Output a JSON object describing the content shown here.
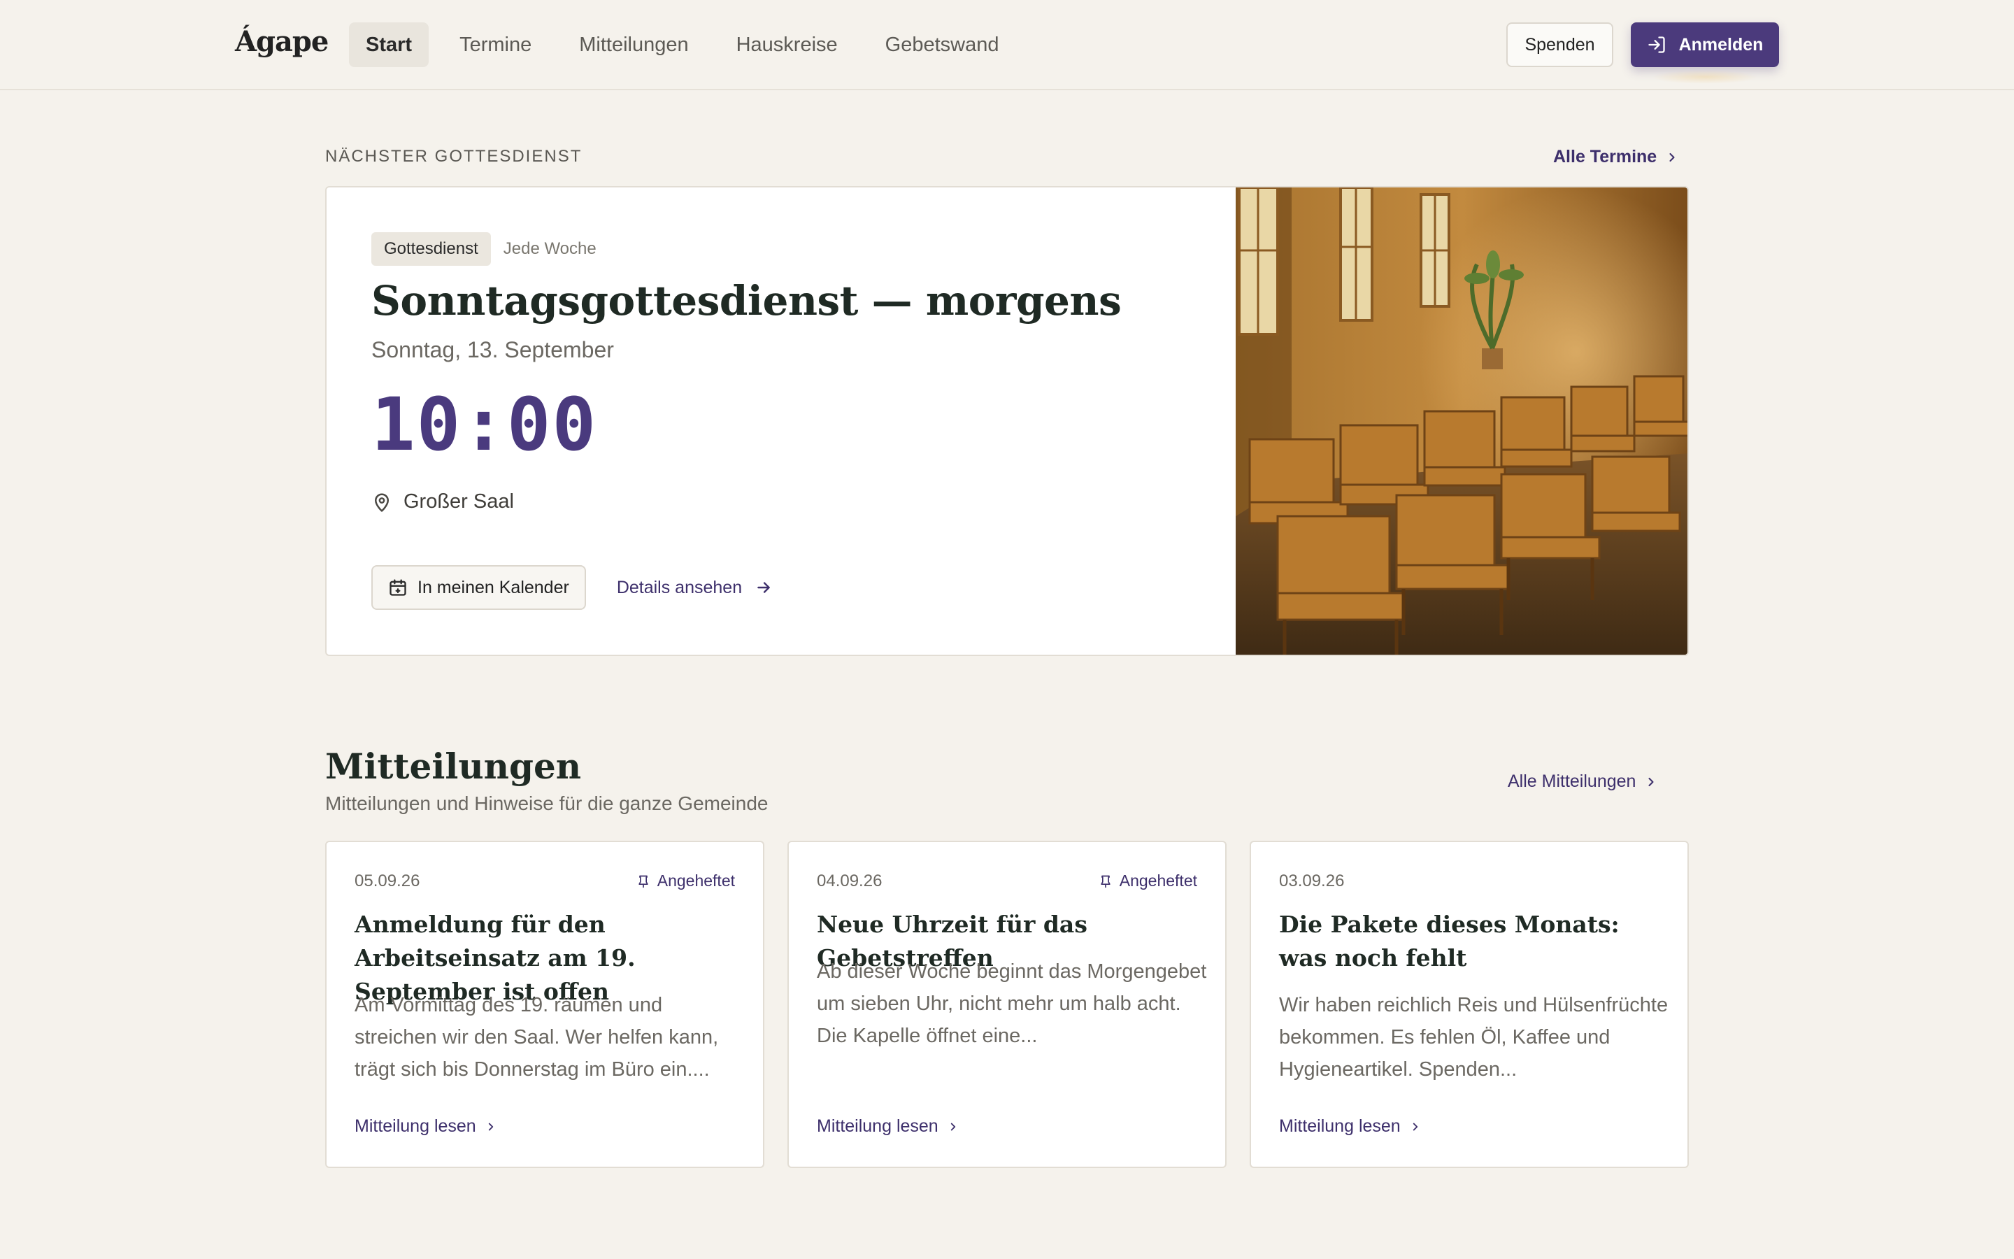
{
  "header": {
    "logo": "Ágape",
    "nav": [
      {
        "label": "Start",
        "active": true
      },
      {
        "label": "Termine"
      },
      {
        "label": "Mitteilungen"
      },
      {
        "label": "Hauskreise"
      },
      {
        "label": "Gebetswand"
      }
    ],
    "donate_label": "Spenden",
    "login_label": "Anmelden"
  },
  "next_service": {
    "section_label": "NÄCHSTER GOTTESDIENST",
    "all_link": "Alle Termine",
    "tag": "Gottesdienst",
    "recurrence": "Jede Woche",
    "title": "Sonntagsgottesdienst — morgens",
    "date": "Sonntag, 13. September",
    "time": "10:00",
    "location": "Großer Saal",
    "calendar_button": "In meinen Kalender",
    "details_link": "Details ansehen",
    "image_description_icon": "church-hall-photo"
  },
  "announcements": {
    "title": "Mitteilungen",
    "subtitle": "Mitteilungen und Hinweise für die ganze Gemeinde",
    "all_link": "Alle Mitteilungen",
    "items": [
      {
        "date": "05.09.26",
        "pinned_label": "Angeheftet",
        "title": "Anmeldung für den Arbeitseinsatz am 19. September ist offen",
        "excerpt": "Am Vormittag des 19. räumen und streichen wir den Saal. Wer helfen kann, trägt sich bis Donnerstag im Büro ein....",
        "link": "Mitteilung lesen"
      },
      {
        "date": "04.09.26",
        "pinned_label": "Angeheftet",
        "title": "Neue Uhrzeit für das Gebetstreffen",
        "excerpt": "Ab dieser Woche beginnt das Morgengebet um sieben Uhr, nicht mehr um halb acht. Die Kapelle öffnet eine...",
        "link": "Mitteilung lesen"
      },
      {
        "date": "03.09.26",
        "pinned_label": "",
        "title": "Die Pakete dieses Monats: was noch fehlt",
        "excerpt": "Wir haben reichlich Reis und Hülsenfrüchte bekommen. Es fehlen Öl, Kaffee und Hygieneartikel. Spenden...",
        "link": "Mitteilung lesen"
      }
    ]
  },
  "colors": {
    "accent": "#4b3a7c",
    "background": "#f5f2ec",
    "time": "#4a3a7e"
  }
}
